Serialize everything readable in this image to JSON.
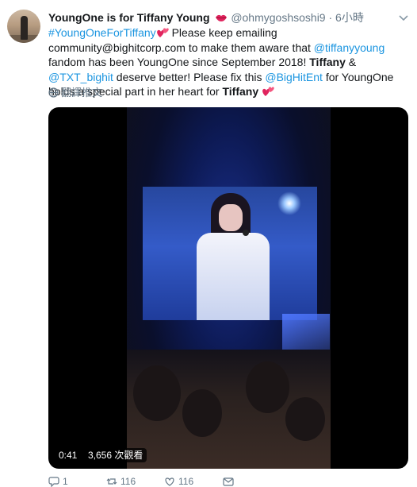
{
  "tweet": {
    "display_name": "YoungOne is for Tiffany Young",
    "handle": "@ohmygoshsoshi9",
    "dot": "·",
    "time": "6小時",
    "text": {
      "hashtag": "#YoungOneForTiffany",
      "p1": " Please keep emailing community@bighitcorp.com to make them aware that ",
      "mention1": "@tiffanyyoung",
      "p2": " fandom has been YoungOne since September 2018! ",
      "bold1": "Tiffany",
      "p3": " & ",
      "mention2": "@TXT_bighit",
      "p4": " deserve better! Please fix this ",
      "mention3": "@BigHitEnt",
      "p5": " for YoungOne holds a special part in her heart for ",
      "bold2": "Tiffany"
    },
    "translate_label": "翻譯推文",
    "media": {
      "duration": "0:41",
      "views": "3,656 次觀看"
    },
    "actions": {
      "reply_count": "1",
      "retweet_count": "116",
      "like_count": "116"
    }
  },
  "icons": {
    "lips": "lips-emoji-icon",
    "heart": "two-hearts-emoji-icon",
    "caret": "chevron-down-icon",
    "globe": "globe-icon",
    "reply": "reply-icon",
    "retweet": "retweet-icon",
    "like": "heart-icon",
    "message": "message-icon"
  },
  "colors": {
    "link": "#1b95e0",
    "secondary_text": "#657786",
    "primary_text": "#14171a",
    "heart_emoji": "#e0245e"
  }
}
